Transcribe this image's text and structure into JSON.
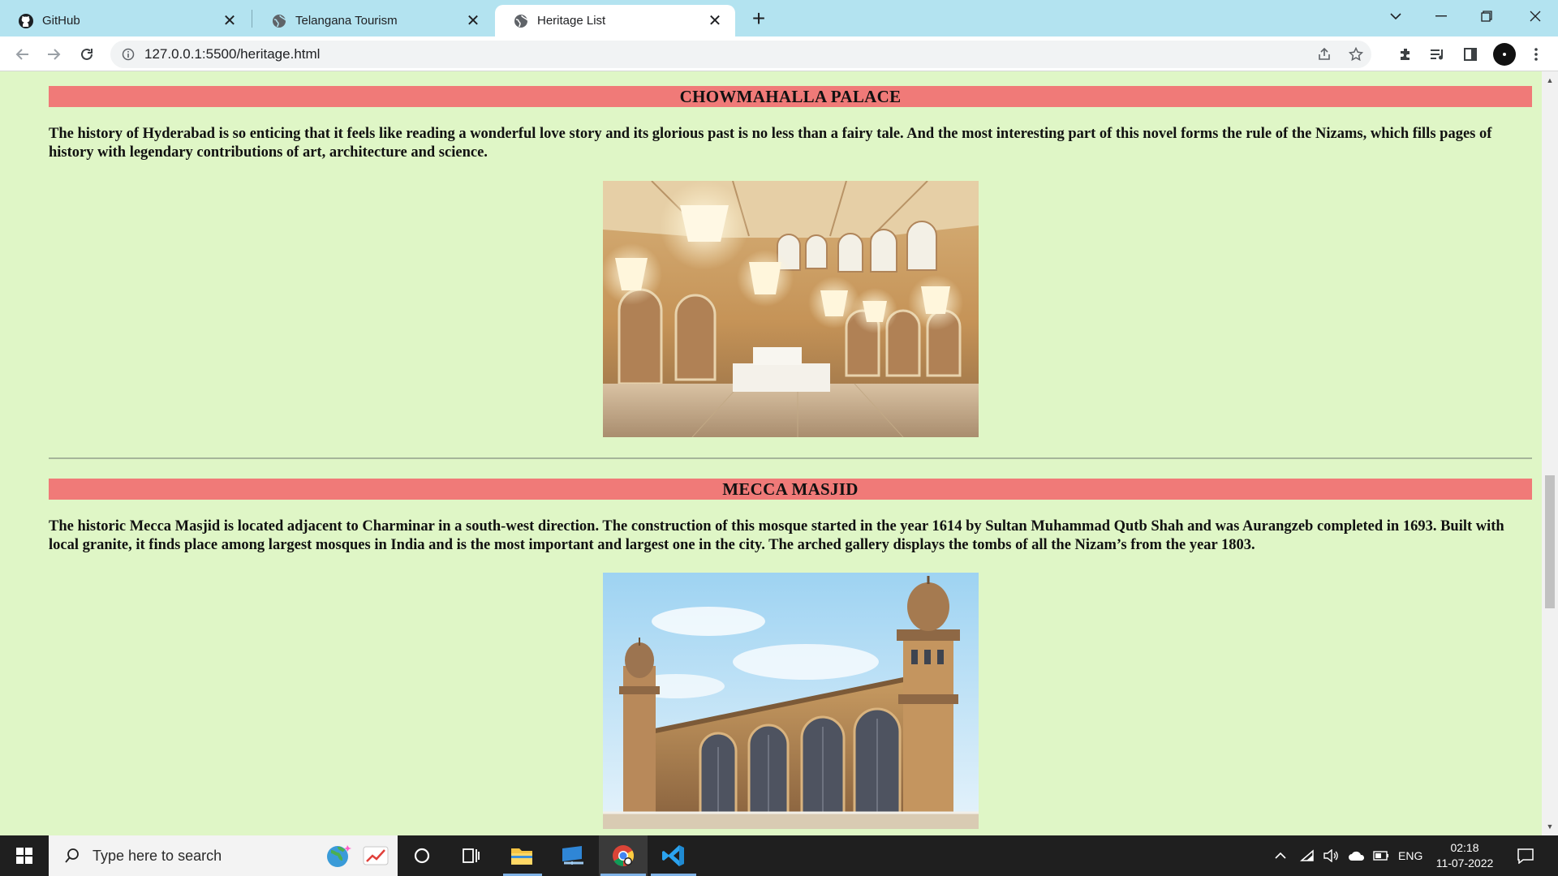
{
  "browser": {
    "tabs": [
      {
        "title": "GitHub",
        "icon": "github-icon"
      },
      {
        "title": "Telangana Tourism",
        "icon": "globe-icon"
      },
      {
        "title": "Heritage List",
        "icon": "globe-icon",
        "active": true
      }
    ],
    "new_tab_label": "+",
    "url": "127.0.0.1:5500/heritage.html"
  },
  "page": {
    "sections": [
      {
        "heading": "CHOWMAHALLA PALACE",
        "description": "The history of Hyderabad is so enticing that it feels like reading a wonderful love story and its glorious past is no less than a fairy tale. And the most interesting part of this novel forms the rule of the Nizams, which fills pages of history with legendary contributions of art, architecture and science.",
        "image": "palace-interior-photo"
      },
      {
        "heading": "MECCA MASJID",
        "description": "The historic Mecca Masjid is located adjacent to Charminar in a south-west direction. The construction of this mosque started in the year 1614 by Sultan Muhammad Qutb Shah and was Aurangzeb completed in 1693. Built with local granite, it finds place among largest mosques in India and is the most important and largest one in the city. The arched gallery displays the tombs of all the Nizam’s from the year 1803.",
        "image": "mosque-exterior-photo"
      }
    ]
  },
  "taskbar": {
    "search_placeholder": "Type here to search",
    "language": "ENG",
    "time": "02:18",
    "date": "11-07-2022"
  },
  "colors": {
    "tabstrip": "#b3e3f0",
    "page_background": "#dff6c6",
    "heading_background": "#f07a78"
  }
}
